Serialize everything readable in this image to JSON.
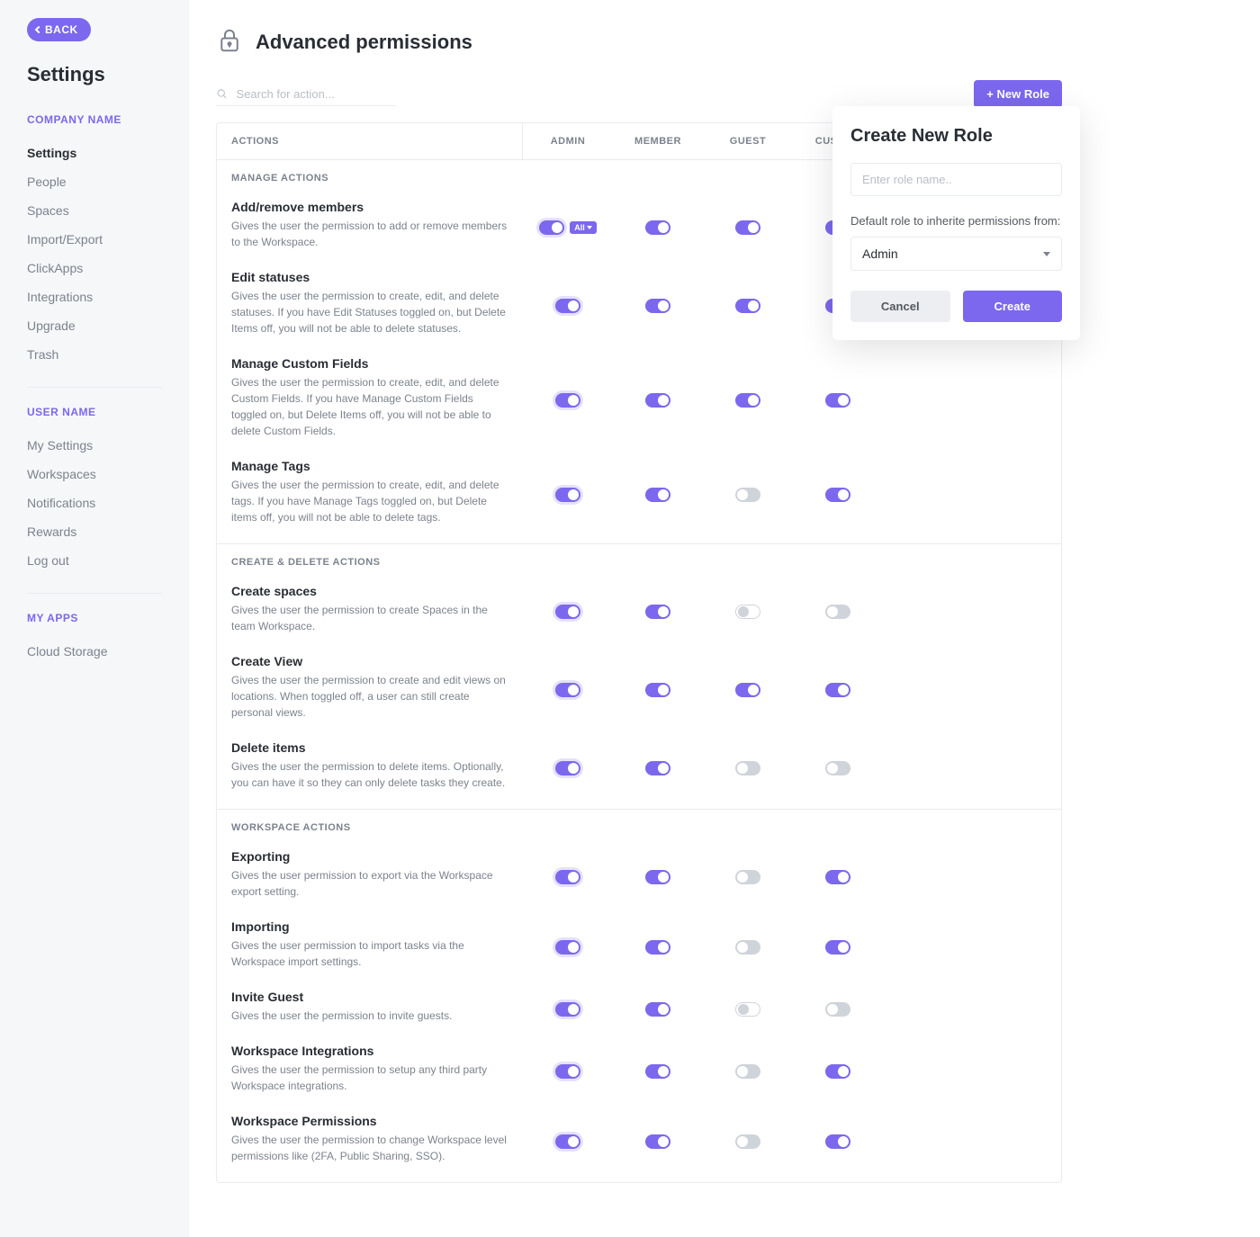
{
  "sidebar": {
    "back": "BACK",
    "title": "Settings",
    "company_heading": "COMPANY NAME",
    "company_items": [
      "Settings",
      "People",
      "Spaces",
      "Import/Export",
      "ClickApps",
      "Integrations",
      "Upgrade",
      "Trash"
    ],
    "user_heading": "USER NAME",
    "user_items": [
      "My Settings",
      "Workspaces",
      "Notifications",
      "Rewards",
      "Log out"
    ],
    "apps_heading": "MY APPS",
    "apps_items": [
      "Cloud Storage"
    ]
  },
  "page": {
    "title": "Advanced permissions",
    "search_placeholder": "Search for action...",
    "new_role": "+ New Role"
  },
  "columns": {
    "actions": "ACTIONS",
    "roles": [
      "ADMIN",
      "MEMBER",
      "GUEST",
      "CUSTOM"
    ]
  },
  "all_badge": "All",
  "groups": [
    {
      "name": "MANAGE ACTIONS",
      "items": [
        {
          "title": "Add/remove members",
          "desc": "Gives the user the permission to add or remove members to the Workspace.",
          "toggles": [
            "admin-on-all",
            "on",
            "on",
            "on"
          ]
        },
        {
          "title": "Edit statuses",
          "desc": "Gives the user the permission to create, edit, and delete statuses. If you have Edit Statuses toggled on, but Delete Items off, you will not be able to delete statuses.",
          "toggles": [
            "admin-on",
            "on",
            "on",
            "on"
          ]
        },
        {
          "title": "Manage Custom Fields",
          "desc": "Gives the user the permission to create, edit, and delete Custom Fields. If you have Manage Custom Fields toggled on, but Delete Items off, you will not be able to delete Custom Fields.",
          "toggles": [
            "admin-on",
            "on",
            "on",
            "on"
          ]
        },
        {
          "title": "Manage Tags",
          "desc": "Gives the user the permission to create, edit, and delete tags. If you have Manage Tags toggled on, but Delete items off, you will not be able to delete tags.",
          "toggles": [
            "admin-on",
            "on",
            "off",
            "on"
          ]
        }
      ]
    },
    {
      "name": "CREATE & DELETE ACTIONS",
      "items": [
        {
          "title": "Create spaces",
          "desc": "Gives the user the permission to create Spaces in the team Workspace.",
          "toggles": [
            "admin-on",
            "on",
            "off-outlined",
            "off"
          ]
        },
        {
          "title": "Create View",
          "desc": "Gives the user the permission to create and edit views on locations. When toggled off, a user can still create personal views.",
          "toggles": [
            "admin-on",
            "on",
            "on",
            "on"
          ]
        },
        {
          "title": "Delete items",
          "desc": "Gives the user the permission to delete items. Optionally, you can have it so they can only delete tasks they create.",
          "toggles": [
            "admin-on",
            "on",
            "off",
            "off"
          ]
        }
      ]
    },
    {
      "name": "WORKSPACE ACTIONS",
      "items": [
        {
          "title": "Exporting",
          "desc": "Gives the user permission to export via the Workspace export setting.",
          "toggles": [
            "admin-on",
            "on",
            "off",
            "on"
          ]
        },
        {
          "title": "Importing",
          "desc": "Gives the user permission to import tasks via the Workspace import settings.",
          "toggles": [
            "admin-on",
            "on",
            "off",
            "on"
          ]
        },
        {
          "title": "Invite Guest",
          "desc": "Gives the user the permission to invite guests.",
          "toggles": [
            "admin-on",
            "on",
            "off-outlined",
            "off"
          ]
        },
        {
          "title": "Workspace Integrations",
          "desc": "Gives the user the permission to setup any third party Workspace integrations.",
          "toggles": [
            "admin-on",
            "on",
            "off",
            "on"
          ]
        },
        {
          "title": "Workspace Permissions",
          "desc": "Gives the user the permission to change Workspace level permissions like (2FA, Public Sharing, SSO).",
          "toggles": [
            "admin-on",
            "on",
            "off",
            "on"
          ]
        }
      ]
    }
  ],
  "popover": {
    "title": "Create New Role",
    "placeholder": "Enter role name..",
    "inherit_label": "Default role to inherite permissions from:",
    "selected": "Admin",
    "cancel": "Cancel",
    "create": "Create"
  }
}
